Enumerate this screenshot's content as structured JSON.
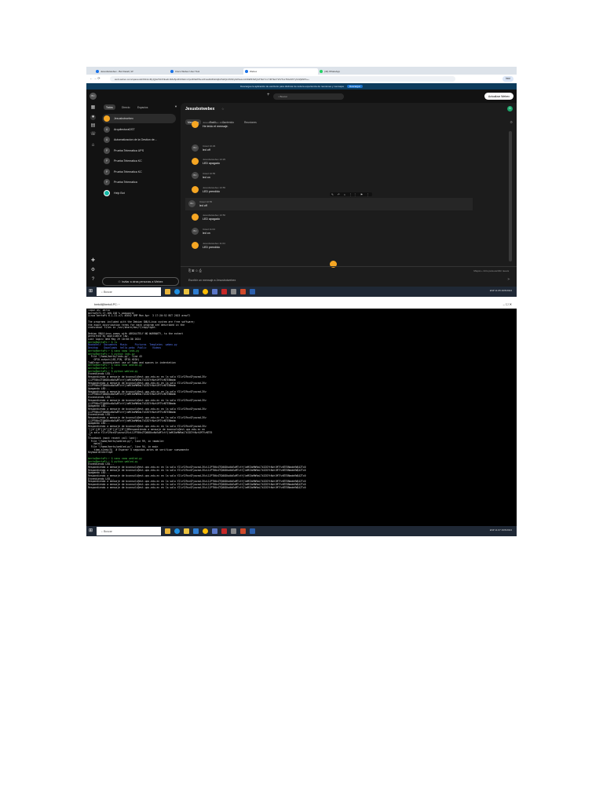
{
  "browser": {
    "tabs": [
      "Jesusbotwebex - Bot Detail | W",
      "Cisco Webex User Tool",
      "Webex",
      "(43) WhatsApp"
    ],
    "url": "web.webex.com/spaces/ah90nHvMyQjIs2S3JVEudLhMe5jo3hG5kdmVpc2RlaWNeL2Fwa0k3hE0djb2S2ZjIcJhtNFpb2SaLsmNDE5NWQzZTEzYmYtMTE2YWVToLTMxZWYyNzZjMWh++",
    "banner_text": "Descargue la aplicación de escritorio para disfrutar de toda la experiencia de reuniones y mensajes",
    "banner_button": "Descargar",
    "profile": "Inici"
  },
  "webex": {
    "user_initials": "BC",
    "search_placeholder": "Buscar",
    "update_button": "Actualizar Webex",
    "filters": [
      "Todos",
      "Directo",
      "Espacios"
    ],
    "spaces": [
      {
        "initial": "",
        "name": "Jesusbotwebex",
        "selected": true
      },
      {
        "initial": "A",
        "name": "ArquitecturaDST"
      },
      {
        "initial": "A",
        "name": "Automatizacion de la Gestion de..."
      },
      {
        "initial": "P",
        "name": "Prueba Telematica UPS"
      },
      {
        "initial": "P",
        "name": "Prueba Telematica KC"
      },
      {
        "initial": "P",
        "name": "Prueba Telematica KC"
      },
      {
        "initial": "P",
        "name": "Prueba Telematica"
      },
      {
        "initial": "",
        "name": "Help Bot"
      }
    ],
    "invite_button": "Invitar a otras personas a Webex",
    "space_title": "Jesusbotwebex",
    "space_avatar": "D",
    "space_tabs": [
      "Mensajes",
      "Perfil",
      "Contenido",
      "Reuniones"
    ],
    "messages": [
      {
        "who": "Jesusbotwebex",
        "time": "10:29",
        "text": "He leído el mensaje.",
        "bot": true
      },
      {
        "who": "Usted",
        "time": "10:29",
        "text": "led off",
        "bot": false
      },
      {
        "who": "Jesusbotwebex",
        "time": "10:29",
        "text": "LED apagado",
        "bot": true
      },
      {
        "who": "Usted",
        "time": "10:55",
        "text": "led on",
        "bot": false
      },
      {
        "who": "Jesusbotwebex",
        "time": "10:55",
        "text": "LED prendido",
        "bot": true
      },
      {
        "who": "Usted",
        "time": "10:55",
        "text": "led off",
        "bot": false
      },
      {
        "who": "Jesusbotwebex",
        "time": "10:56",
        "text": "LED apagado",
        "bot": true
      },
      {
        "who": "Usted",
        "time": "11:04",
        "text": "led on",
        "bot": false
      },
      {
        "who": "Jesusbotwebex",
        "time": "11:04",
        "text": "LED prendido",
        "bot": true
      }
    ],
    "compose_hint": "Mayús + Intro para escribir nueva",
    "compose_placeholder": "Escribir un mensaje a Jesusbotwebex"
  },
  "taskbar": {
    "search": "Buscar",
    "lang": "ESP",
    "time1": "11:05",
    "time2": "11:07",
    "date": "29/5/2024"
  },
  "terminal": {
    "title": "bertoll@bertoll-PC: ~",
    "lines": [
      {
        "c": "",
        "t": "login as: berto"
      },
      {
        "c": "",
        "t": "berto@172.17.160.158's password:"
      },
      {
        "c": "",
        "t": "Linux bertoPi 6.1.21-v7+ #1642 SMP Mon Apr  3 17:20:52 BST 2023 armv7l"
      },
      {
        "c": "",
        "t": ""
      },
      {
        "c": "",
        "t": "The programs included with the Debian GNU/Linux system are free software;"
      },
      {
        "c": "",
        "t": "the exact distribution terms for each program are described in the"
      },
      {
        "c": "",
        "t": "individual files in /usr/share/doc/*/copyright."
      },
      {
        "c": "",
        "t": ""
      },
      {
        "c": "",
        "t": "Debian GNU/Linux comes with ABSOLUTELY NO WARRANTY, to the extent"
      },
      {
        "c": "",
        "t": "permitted by applicable law."
      },
      {
        "c": "",
        "t": "Last login: Wed May 29 10:50:30 2024"
      },
      {
        "c": "g",
        "t": "berto@bertoPi:~ $ ls"
      },
      {
        "c": "b",
        "t": "Bookshelf  Documents  Music     Pictures  Templates  webex.py"
      },
      {
        "c": "b",
        "t": "Desktop    Downloads  hello.webx  Public    Videos"
      },
      {
        "c": "g",
        "t": "berto@bertoPi:~ $ nano nano leds.py"
      },
      {
        "c": "g",
        "t": "berto@bertoPi:~ $ python leds.py"
      },
      {
        "c": "",
        "t": "  File \"/home/berto/leds.py\", line 43"
      },
      {
        "c": "",
        "t": "    GPIO.output(LED_PIN, GPIO.HIGH)"
      },
      {
        "c": "",
        "t": "TabError: inconsistent use of tabs and spaces in indentation"
      },
      {
        "c": "g",
        "t": "berto@bertoPi:~ $ nano nano webled.py"
      },
      {
        "c": "g",
        "t": "berto@bertoPi:~ $"
      },
      {
        "c": "g",
        "t": "berto@bertoPi:~ $ python webled.py"
      },
      {
        "c": "",
        "t": "Encendiendo LED..."
      },
      {
        "c": "",
        "t": "Respondiendo a mensaje de bconsoli@est.ups.edu.ec en la sala Y2lzY29zcGFyazovL3Vz"
      },
      {
        "c": "",
        "t": "L1JPT00vZTQ0ODkxNzEwMTctYjlmMC0xMWVmLTk3ZGYtNzhlMTYzNTE5Nmdm"
      },
      {
        "c": "",
        "t": "Respondiendo a mensaje de bconsoli@est.ups.edu.ec en la sala Y2lzY29zcGFyazovL3Vz"
      },
      {
        "c": "",
        "t": "L1JPT00vZTQ0ODkxNzEwMTctYjlmMC0xMWVmLTk3ZGYtNzhlMTYzNTE5Nmdm"
      },
      {
        "c": "",
        "t": "Apagando LED..."
      },
      {
        "c": "",
        "t": "Respondiendo a mensaje de bconsoli@est.ups.edu.ec en la sala Y2lzY29zcGFyazovL3Vz"
      },
      {
        "c": "",
        "t": "L1JPT00vZTQ0ODkxNzEwMTctYjlmMC0xMWVmLTk3ZGYtNzhlMTYzNTE5Nmdm"
      },
      {
        "c": "",
        "t": "Encendiendo LED..."
      },
      {
        "c": "",
        "t": "Respondiendo a mensaje de bconsoli@est.ups.edu.ec en la sala Y2lzY29zcGFyazovL3Vz"
      },
      {
        "c": "",
        "t": "L1JPT00vZTQ0ODkxNzEwMTctYjlmMC0xMWVmLTk3ZGYtNzhlMTYzNTE5Nmdm"
      },
      {
        "c": "",
        "t": "Apagando LED..."
      },
      {
        "c": "",
        "t": "Respondiendo a mensaje de bconsoli@est.ups.edu.ec en la sala Y2lzY29zcGFyazovL3Vz"
      },
      {
        "c": "",
        "t": "L1JPT00vZTQ0ODkxNzEwMTctYjlmMC0xMWVmLTk3ZGYtNzhlMTYzNTE5Nmdm"
      },
      {
        "c": "",
        "t": "Encendiendo LED..."
      },
      {
        "c": "",
        "t": "Respondiendo a mensaje de bconsoli@est.ups.edu.ec en la sala Y2lzY29zcGFyazovL3Vz"
      },
      {
        "c": "",
        "t": "L1JPT00vZTQ0ODkxNzEwMTctYjlmMC0xMWVmLTk3ZGYtNzhlMTYzNTE5Nmdm"
      },
      {
        "c": "",
        "t": "Apagando LED..."
      },
      {
        "c": "",
        "t": "Respondiendo a mensaje de bconsoli@est.ups.edu.ec en la sala Y2lzY29zcGFyazovL3Vz"
      },
      {
        "c": "",
        "t": "^[[A^[[B^[[A^[[B^[[A^[[B^[[BRespondiendo a mensaje de bconsoli@est.ups.edu.ec en"
      },
      {
        "c": "",
        "t": " la sala Y2lzY29zcGFyazovL3VzL1JPT00vZTQ0ODkxNzEwMTctYjlmMC0xMWVmLTk3ZGYtNzhlMTYzNTE5"
      },
      {
        "c": "",
        "t": "^C"
      },
      {
        "c": "",
        "t": "Traceback (most recent call last):"
      },
      {
        "c": "",
        "t": "  File \"/home/berto/webled.py\", line 99, in <module>"
      },
      {
        "c": "",
        "t": "    main()"
      },
      {
        "c": "",
        "t": "  File \"/home/berto/webled.py\", line 94, in main"
      },
      {
        "c": "",
        "t": "    time.sleep(5)  # Esperar 5 segundos antes de verificar nuevamente"
      },
      {
        "c": "",
        "t": "KeyboardInterrupt"
      },
      {
        "c": "",
        "t": ""
      },
      {
        "c": "g",
        "t": "berto@bertoPi:~ $ nano nano webled.py"
      },
      {
        "c": "g",
        "t": "berto@bertoPi:~ $ python webled.py"
      },
      {
        "c": "",
        "t": "Encendiendo LED..."
      },
      {
        "c": "",
        "t": "Respondiendo a mensaje de bconsoli@est.ups.edu.ec en la sala Y2lzY29zcGFyazovL3VzL1JPT00vZTQ0ODkxNzEwMTctYjlmMC0xMWVmLTk3ZGYtNzhlMTYzNTE5NmdmYWQ4ZTc0"
      },
      {
        "c": "",
        "t": "Respondiendo a mensaje de bconsoli@est.ups.edu.ec en la sala Y2lzY29zcGFyazovL3VzL1JPT00vZTQ0ODkxNzEwMTctYjlmMC0xMWVmLTk3ZGYtNzhlMTYzNTE5NmdmYWQ4ZTc0"
      },
      {
        "c": "",
        "t": "Apagando LED..."
      },
      {
        "c": "",
        "t": "Respondiendo a mensaje de bconsoli@est.ups.edu.ec en la sala Y2lzY29zcGFyazovL3VzL1JPT00vZTQ0ODkxNzEwMTctYjlmMC0xMWVmLTk3ZGYtNzhlMTYzNTE5NmdmYWQ4ZTc0"
      },
      {
        "c": "",
        "t": "Encendiendo LED..."
      },
      {
        "c": "",
        "t": "Respondiendo a mensaje de bconsoli@est.ups.edu.ec en la sala Y2lzY29zcGFyazovL3VzL1JPT00vZTQ0ODkxNzEwMTctYjlmMC0xMWVmLTk3ZGYtNzhlMTYzNTE5NmdmYWQ4ZTc0"
      },
      {
        "c": "",
        "t": "Respondiendo a mensaje de bconsoli@est.ups.edu.ec en la sala Y2lzY29zcGFyazovL3VzL1JPT00vZTQ0ODkxNzEwMTctYjlmMC0xMWVmLTk3ZGYtNzhlMTYzNTE5NmdmYWQ4ZTc0"
      },
      {
        "c": "",
        "t": "Respondiendo a mensaje de bconsoli@est.ups.edu.ec en la sala Y2lzY29zcGFyazovL3VzL1JPT00vZTQ0ODkxNzEwMTctYjlmMC0xMWVmLTk3ZGYtNzhlMTYzNTE5NmdmYWQ4ZTc0"
      }
    ]
  }
}
